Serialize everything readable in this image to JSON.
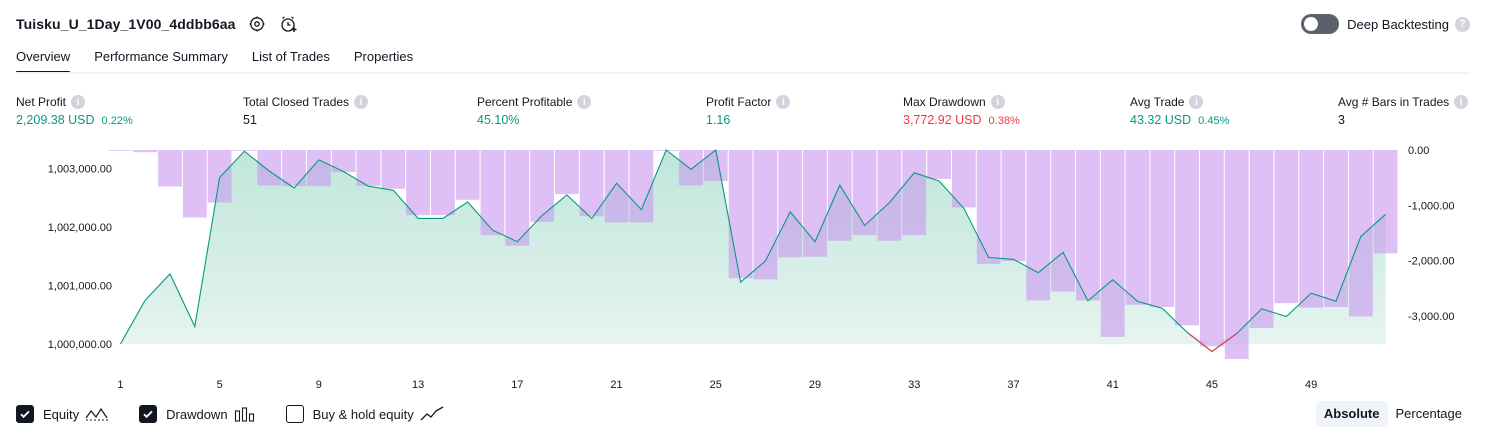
{
  "header": {
    "title": "Tuisku_U_1Day_1V00_4ddbb6aa"
  },
  "deep_backtesting": {
    "label": "Deep Backtesting",
    "help": "?"
  },
  "tabs": [
    {
      "label": "Overview"
    },
    {
      "label": "Performance Summary"
    },
    {
      "label": "List of Trades"
    },
    {
      "label": "Properties"
    }
  ],
  "metrics": [
    {
      "label": "Net Profit",
      "value": "2,209.38 USD",
      "sub": "0.22%",
      "color": "green"
    },
    {
      "label": "Total Closed Trades",
      "value": "51",
      "sub": "",
      "color": "dark"
    },
    {
      "label": "Percent Profitable",
      "value": "45.10%",
      "sub": "",
      "color": "green"
    },
    {
      "label": "Profit Factor",
      "value": "1.16",
      "sub": "",
      "color": "green"
    },
    {
      "label": "Max Drawdown",
      "value": "3,772.92 USD",
      "sub": "0.38%",
      "color": "red"
    },
    {
      "label": "Avg Trade",
      "value": "43.32 USD",
      "sub": "0.45%",
      "color": "green"
    },
    {
      "label": "Avg # Bars in Trades",
      "value": "3",
      "sub": "",
      "color": "dark"
    }
  ],
  "chart_data": {
    "type": "area",
    "x": [
      1,
      2,
      3,
      4,
      5,
      6,
      7,
      8,
      9,
      10,
      11,
      12,
      13,
      14,
      15,
      16,
      17,
      18,
      19,
      20,
      21,
      22,
      23,
      24,
      25,
      26,
      27,
      28,
      29,
      30,
      31,
      32,
      33,
      34,
      35,
      36,
      37,
      38,
      39,
      40,
      41,
      42,
      43,
      44,
      45,
      46,
      47,
      48,
      49,
      50,
      51,
      52
    ],
    "x_ticks": [
      "1",
      "5",
      "9",
      "13",
      "17",
      "21",
      "25",
      "29",
      "33",
      "37",
      "41",
      "45",
      "49"
    ],
    "y_left_ticks": [
      "1,003,000.00",
      "1,002,000.00",
      "1,001,000.00",
      "1,000,000.00"
    ],
    "y_right_ticks": [
      "0.00",
      "-1,000.00",
      "-2,000.00",
      "-3,000.00"
    ],
    "y_left_range": [
      999950,
      1003330
    ],
    "y_right_range": [
      -3980,
      0
    ],
    "series": [
      {
        "kind": "equity",
        "values": [
          1000000,
          1000750,
          1001200,
          1000300,
          1002850,
          1003300,
          1002960,
          1002670,
          1003150,
          1002950,
          1002700,
          1002630,
          1002150,
          1002150,
          1002430,
          1001950,
          1001750,
          1002200,
          1002550,
          1002150,
          1002750,
          1002300,
          1003320,
          1002990,
          1003320,
          1001060,
          1001420,
          1002260,
          1001750,
          1002720,
          1002030,
          1002420,
          1002930,
          1002790,
          1002320,
          1001480,
          1001450,
          1001220,
          1001570,
          1000740,
          1001100,
          1000730,
          1000610,
          1000200,
          999870,
          1000180,
          1000600,
          1000470,
          1000870,
          1000730,
          1001840,
          1002220
        ],
        "color": "#089981"
      },
      {
        "kind": "drawdown",
        "values": [
          0,
          -40,
          -660,
          -1220,
          -950,
          0,
          -640,
          -650,
          -650,
          -400,
          -650,
          -700,
          -1180,
          -1180,
          -900,
          -1540,
          -1730,
          -1300,
          -800,
          -1200,
          -1310,
          -1310,
          0,
          -640,
          -560,
          -2320,
          -2340,
          -1940,
          -1930,
          -1640,
          -1540,
          -1640,
          -1540,
          -520,
          -1040,
          -2060,
          -2010,
          -2720,
          -2560,
          -2720,
          -3380,
          -2800,
          -2840,
          -3170,
          -3550,
          -3780,
          -3220,
          -2770,
          -2850,
          -2840,
          -3010,
          -1870
        ],
        "color": "#ce93d8"
      }
    ],
    "grid": false,
    "legend": [
      {
        "label": "Equity",
        "checked": true,
        "icon": "equity-line-icon"
      },
      {
        "label": "Drawdown",
        "checked": true,
        "icon": "drawdown-bars-icon"
      },
      {
        "label": "Buy & hold equity",
        "checked": false,
        "icon": "buy-hold-line-icon"
      }
    ]
  },
  "modes": [
    {
      "label": "Absolute",
      "active": true
    },
    {
      "label": "Percentage",
      "active": false
    }
  ],
  "colors": {
    "positive": "#089981",
    "negative": "#f23645",
    "drawdown_fill": "#e1bee7",
    "equity_fill": "#d7efe8",
    "text": "#131722"
  }
}
